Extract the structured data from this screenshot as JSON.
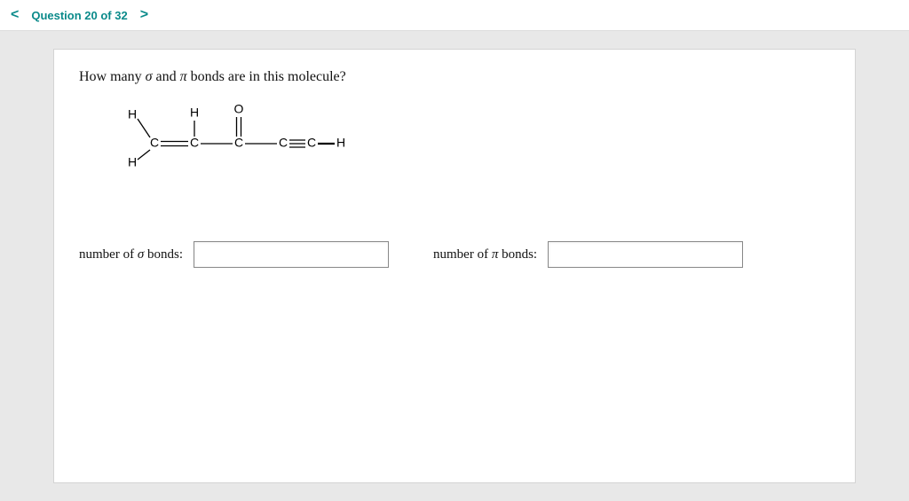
{
  "nav": {
    "prev_glyph": "<",
    "next_glyph": ">",
    "question_label": "Question 20 of 32"
  },
  "question": {
    "prompt_prefix": "How many ",
    "sigma_char": "σ",
    "prompt_mid": " and ",
    "pi_char": "π",
    "prompt_suffix": " bonds are in this molecule?"
  },
  "molecule": {
    "labels": {
      "H_top_left": "H",
      "H_bot_left": "H",
      "H_mid": "H",
      "O_mid": "O",
      "C1": "C",
      "C2": "C",
      "C3": "C",
      "C4": "C",
      "C5": "C",
      "H_right": "H"
    }
  },
  "answers": {
    "sigma_label_prefix": "number of ",
    "sigma_char": "σ",
    "sigma_label_suffix": " bonds:",
    "pi_label_prefix": "number of ",
    "pi_char": "π",
    "pi_label_suffix": " bonds:",
    "sigma_value": "",
    "pi_value": ""
  }
}
